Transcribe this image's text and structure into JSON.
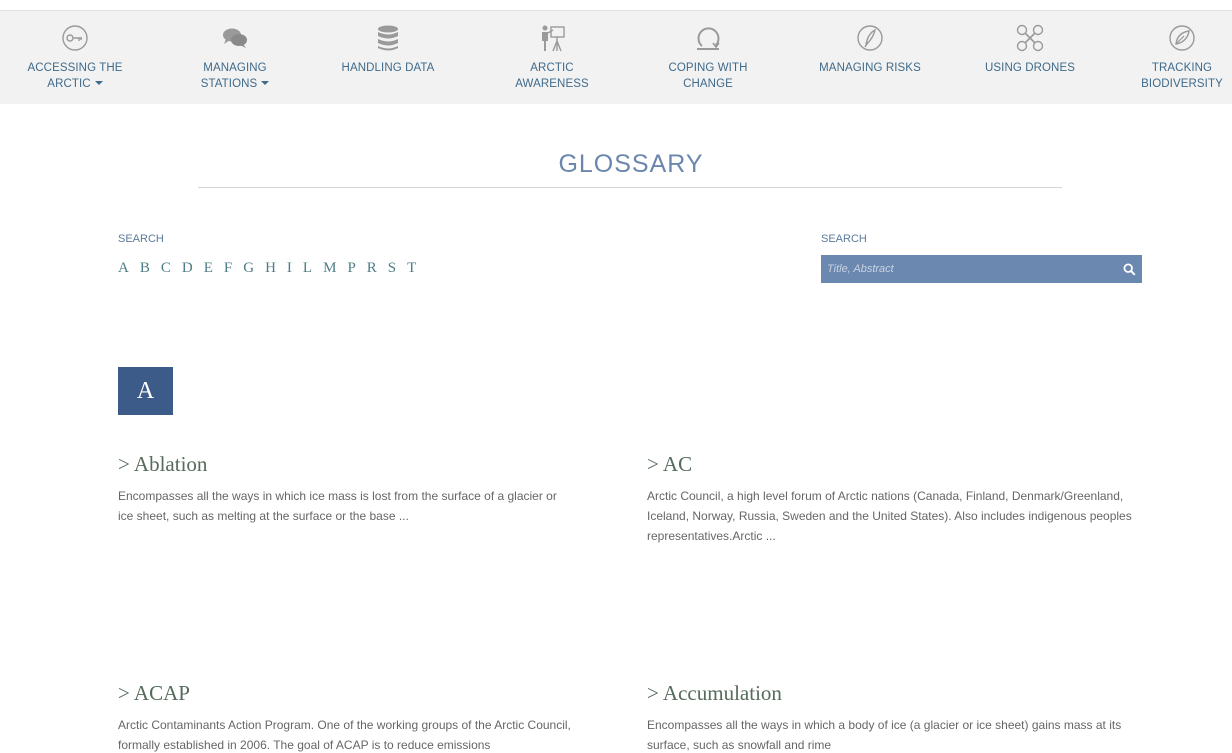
{
  "nav": {
    "items": [
      {
        "label_line1": "ACCESSING THE",
        "label_line2": "ARCTIC",
        "has_caret": true,
        "icon": "key-icon"
      },
      {
        "label_line1": "MANAGING",
        "label_line2": "STATIONS",
        "has_caret": true,
        "icon": "chat-bubbles-icon"
      },
      {
        "label_line1": "HANDLING DATA",
        "label_line2": "",
        "has_caret": false,
        "icon": "database-icon"
      },
      {
        "label_line1": "ARCTIC",
        "label_line2": "AWARENESS",
        "has_caret": false,
        "icon": "presenter-icon"
      },
      {
        "label_line1": "COPING WITH",
        "label_line2": "CHANGE",
        "has_caret": false,
        "icon": "cycle-icon"
      },
      {
        "label_line1": "MANAGING RISKS",
        "label_line2": "",
        "has_caret": false,
        "icon": "feather-circle-icon"
      },
      {
        "label_line1": "USING DRONES",
        "label_line2": "",
        "has_caret": false,
        "icon": "drone-icon"
      },
      {
        "label_line1": "TRACKING",
        "label_line2": "BIODIVERSITY",
        "has_caret": false,
        "icon": "leaf-circle-icon"
      }
    ]
  },
  "page": {
    "title": "GLOSSARY"
  },
  "alphabet": {
    "label": "SEARCH",
    "letters": [
      "A",
      "B",
      "C",
      "D",
      "E",
      "F",
      "G",
      "H",
      "I",
      "L",
      "M",
      "P",
      "R",
      "S",
      "T"
    ]
  },
  "search": {
    "label": "SEARCH",
    "placeholder": "Title, Abstract",
    "value": ""
  },
  "section": {
    "letter": "A"
  },
  "entries": [
    {
      "title": "> Ablation",
      "text": "Encompasses all the ways in which ice mass is lost from the surface of a glacier or ice sheet, such as melting at the surface or the base ..."
    },
    {
      "title": "> AC",
      "text": "Arctic Council, a high level forum of Arctic nations (Canada, Finland, Denmark/Greenland, Iceland, Norway, Russia, Sweden and the United States). Also includes indigenous peoples representatives.Arctic ..."
    },
    {
      "title": "> ACAP",
      "text": "Arctic Contaminants Action Program. One of the working groups of the Arctic Council, formally established in 2006. The goal of ACAP is to reduce emissions"
    },
    {
      "title": "> Accumulation",
      "text": "Encompasses all the ways in which a body of ice (a glacier or ice sheet) gains mass at its surface, such as snowfall and rime"
    }
  ],
  "colors": {
    "accent": "#6b88b0",
    "nav_text": "#3f6a8a",
    "badge": "#3d5b89",
    "entry_title": "#556b5b"
  }
}
